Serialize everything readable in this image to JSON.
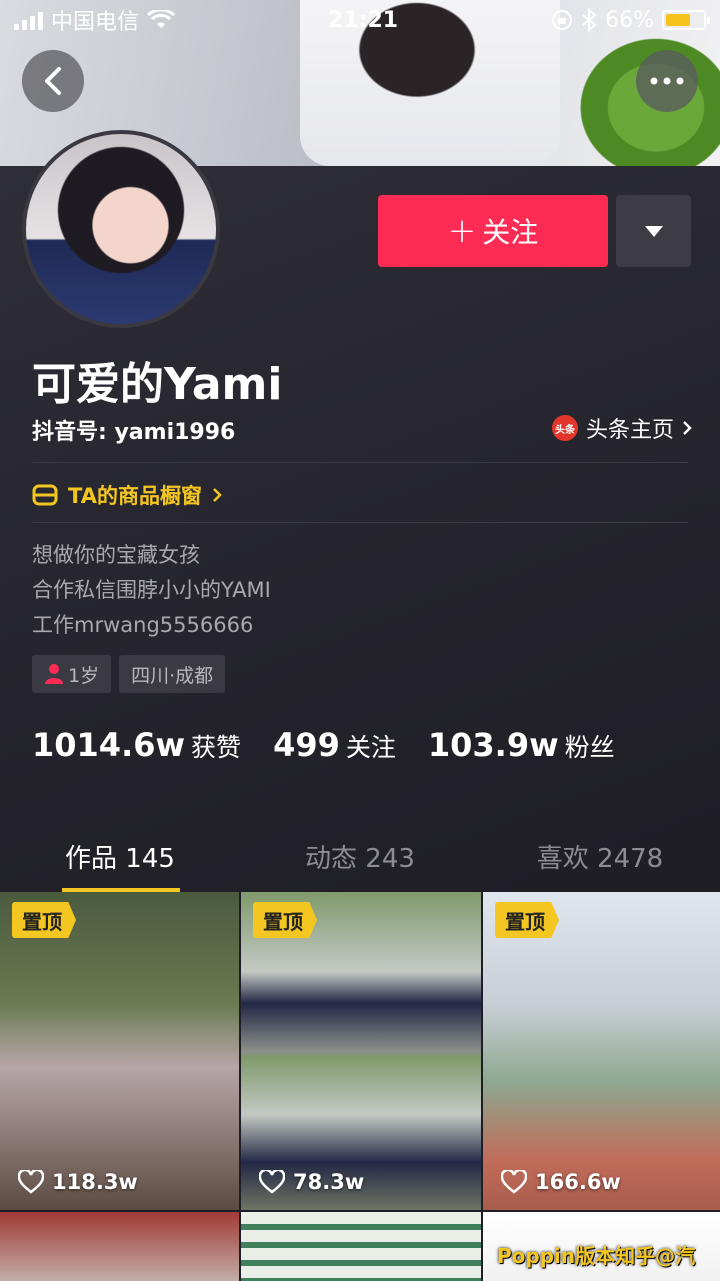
{
  "status_bar": {
    "carrier": "中国电信",
    "time": "21:21",
    "battery": "66%",
    "battery_level": 0.66
  },
  "header": {
    "back_icon": "chevron-left-icon",
    "more_icon": "more-dots-icon"
  },
  "profile": {
    "follow_label": "关注",
    "name": "可爱的Yami",
    "douyin_id": "抖音号: yami1996",
    "toutiao_logo_text": "头条",
    "toutiao_label": "头条主页",
    "shop_label": "TA的商品橱窗",
    "bio": [
      "想做你的宝藏女孩",
      "合作私信围脖小小的YAMI",
      "工作mrwang5556666"
    ],
    "tags": [
      {
        "icon": "female-icon",
        "label": "1岁"
      },
      {
        "label": "四川·成都"
      }
    ],
    "stats": [
      {
        "num": "1014.6w",
        "label": "获赞"
      },
      {
        "num": "499",
        "label": "关注"
      },
      {
        "num": "103.9w",
        "label": "粉丝"
      }
    ]
  },
  "tabs": [
    {
      "label": "作品 145",
      "active": true
    },
    {
      "label": "动态 243",
      "active": false
    },
    {
      "label": "喜欢 2478",
      "active": false
    }
  ],
  "videos": [
    {
      "pinned_label": "置顶",
      "likes": "118.3w"
    },
    {
      "pinned_label": "置顶",
      "likes": "78.3w"
    },
    {
      "pinned_label": "置顶",
      "likes": "166.6w"
    },
    {
      "overlay": ""
    },
    {
      "overlay": ""
    },
    {
      "overlay": "Poppin版本知乎@汽"
    }
  ],
  "colors": {
    "accent_red": "#fe2c55",
    "accent_yellow": "#f4c622",
    "background": "#1f1e26"
  }
}
